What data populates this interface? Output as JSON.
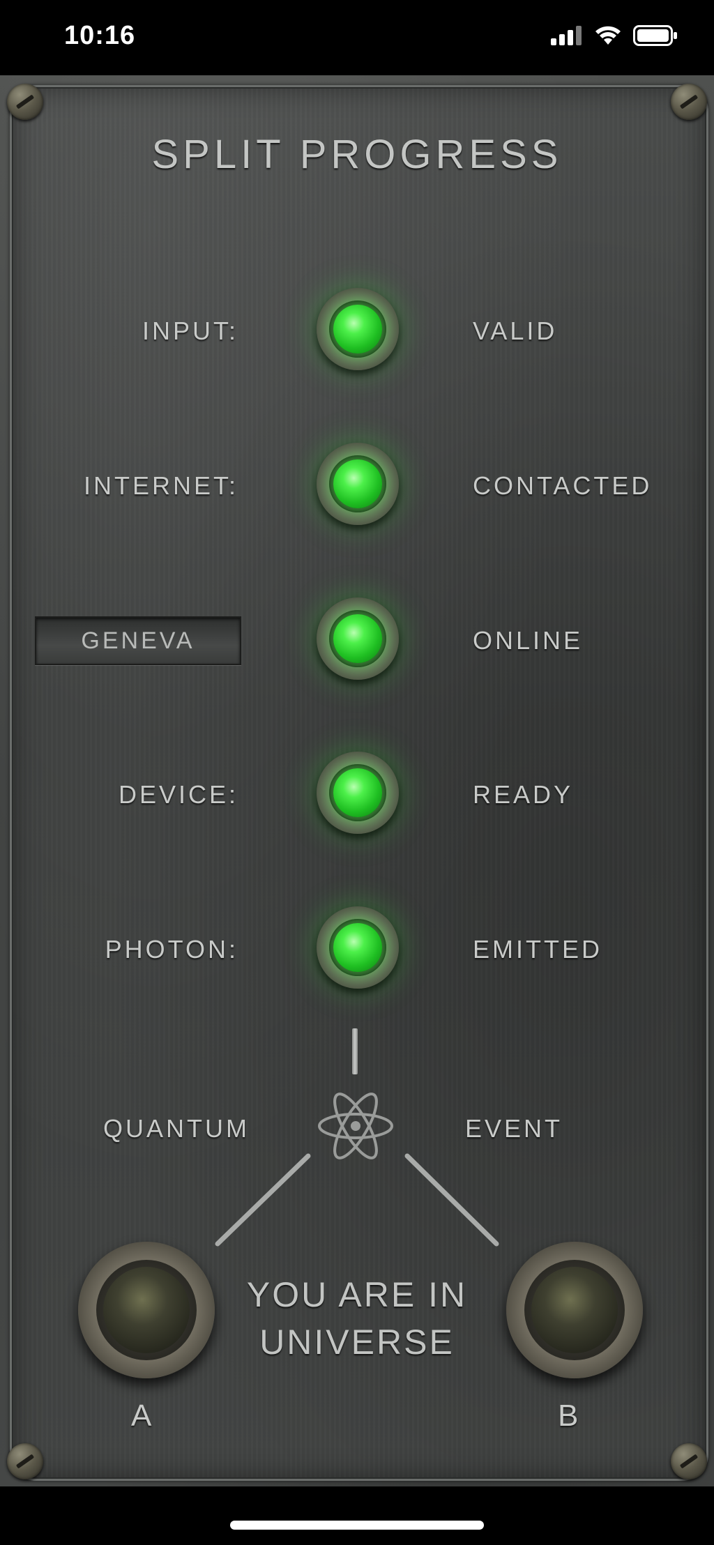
{
  "status_bar": {
    "time": "10:16"
  },
  "title": "SPLIT PROGRESS",
  "rows": [
    {
      "label": "INPUT:",
      "status": "VALID"
    },
    {
      "label": "INTERNET:",
      "status": "CONTACTED"
    },
    {
      "label": "GENEVA",
      "status": "ONLINE"
    },
    {
      "label": "DEVICE:",
      "status": "READY"
    },
    {
      "label": "PHOTON:",
      "status": "EMITTED"
    }
  ],
  "quantum": {
    "left": "QUANTUM",
    "right": "EVENT"
  },
  "universe": {
    "line1": "YOU ARE IN",
    "line2": "UNIVERSE"
  },
  "outcomes": {
    "a": "A",
    "b": "B"
  },
  "colors": {
    "led_on": "#3fe23a",
    "text": "#c9cbc9",
    "panel": "#424443"
  }
}
